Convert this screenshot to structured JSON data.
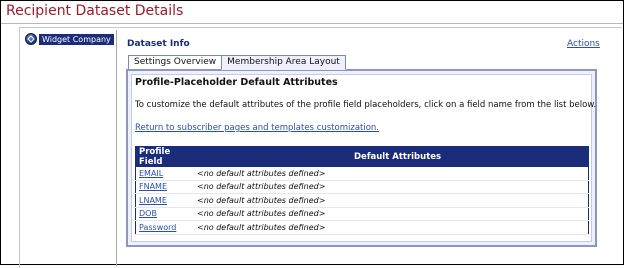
{
  "page": {
    "title": "Recipient Dataset Details"
  },
  "sidebar": {
    "company_name": "Widget Company"
  },
  "section": {
    "title": "Dataset Info",
    "actions_label": "Actions"
  },
  "tabs": [
    {
      "label": "Settings Overview",
      "active": false
    },
    {
      "label": "Membership Area Layout",
      "active": true
    }
  ],
  "panel": {
    "heading": "Profile-Placeholder Default Attributes",
    "description": "To customize the default attributes of the profile field placeholders, click on a field name from the list below.",
    "return_link": "Return to subscriber pages and templates customization."
  },
  "table": {
    "headers": [
      "Profile Field",
      "Default Attributes"
    ],
    "rows": [
      {
        "field": "EMAIL",
        "value": "<no default attributes defined>"
      },
      {
        "field": "FNAME",
        "value": "<no default attributes defined>"
      },
      {
        "field": "LNAME",
        "value": "<no default attributes defined>"
      },
      {
        "field": "DOB",
        "value": "<no default attributes defined>"
      },
      {
        "field": "Password",
        "value": "<no default attributes defined>"
      }
    ]
  },
  "colors": {
    "title": "#9b1b2a",
    "navy": "#1b2d7a",
    "link": "#2b4ea6",
    "panel_bg": "#eef1fb"
  }
}
